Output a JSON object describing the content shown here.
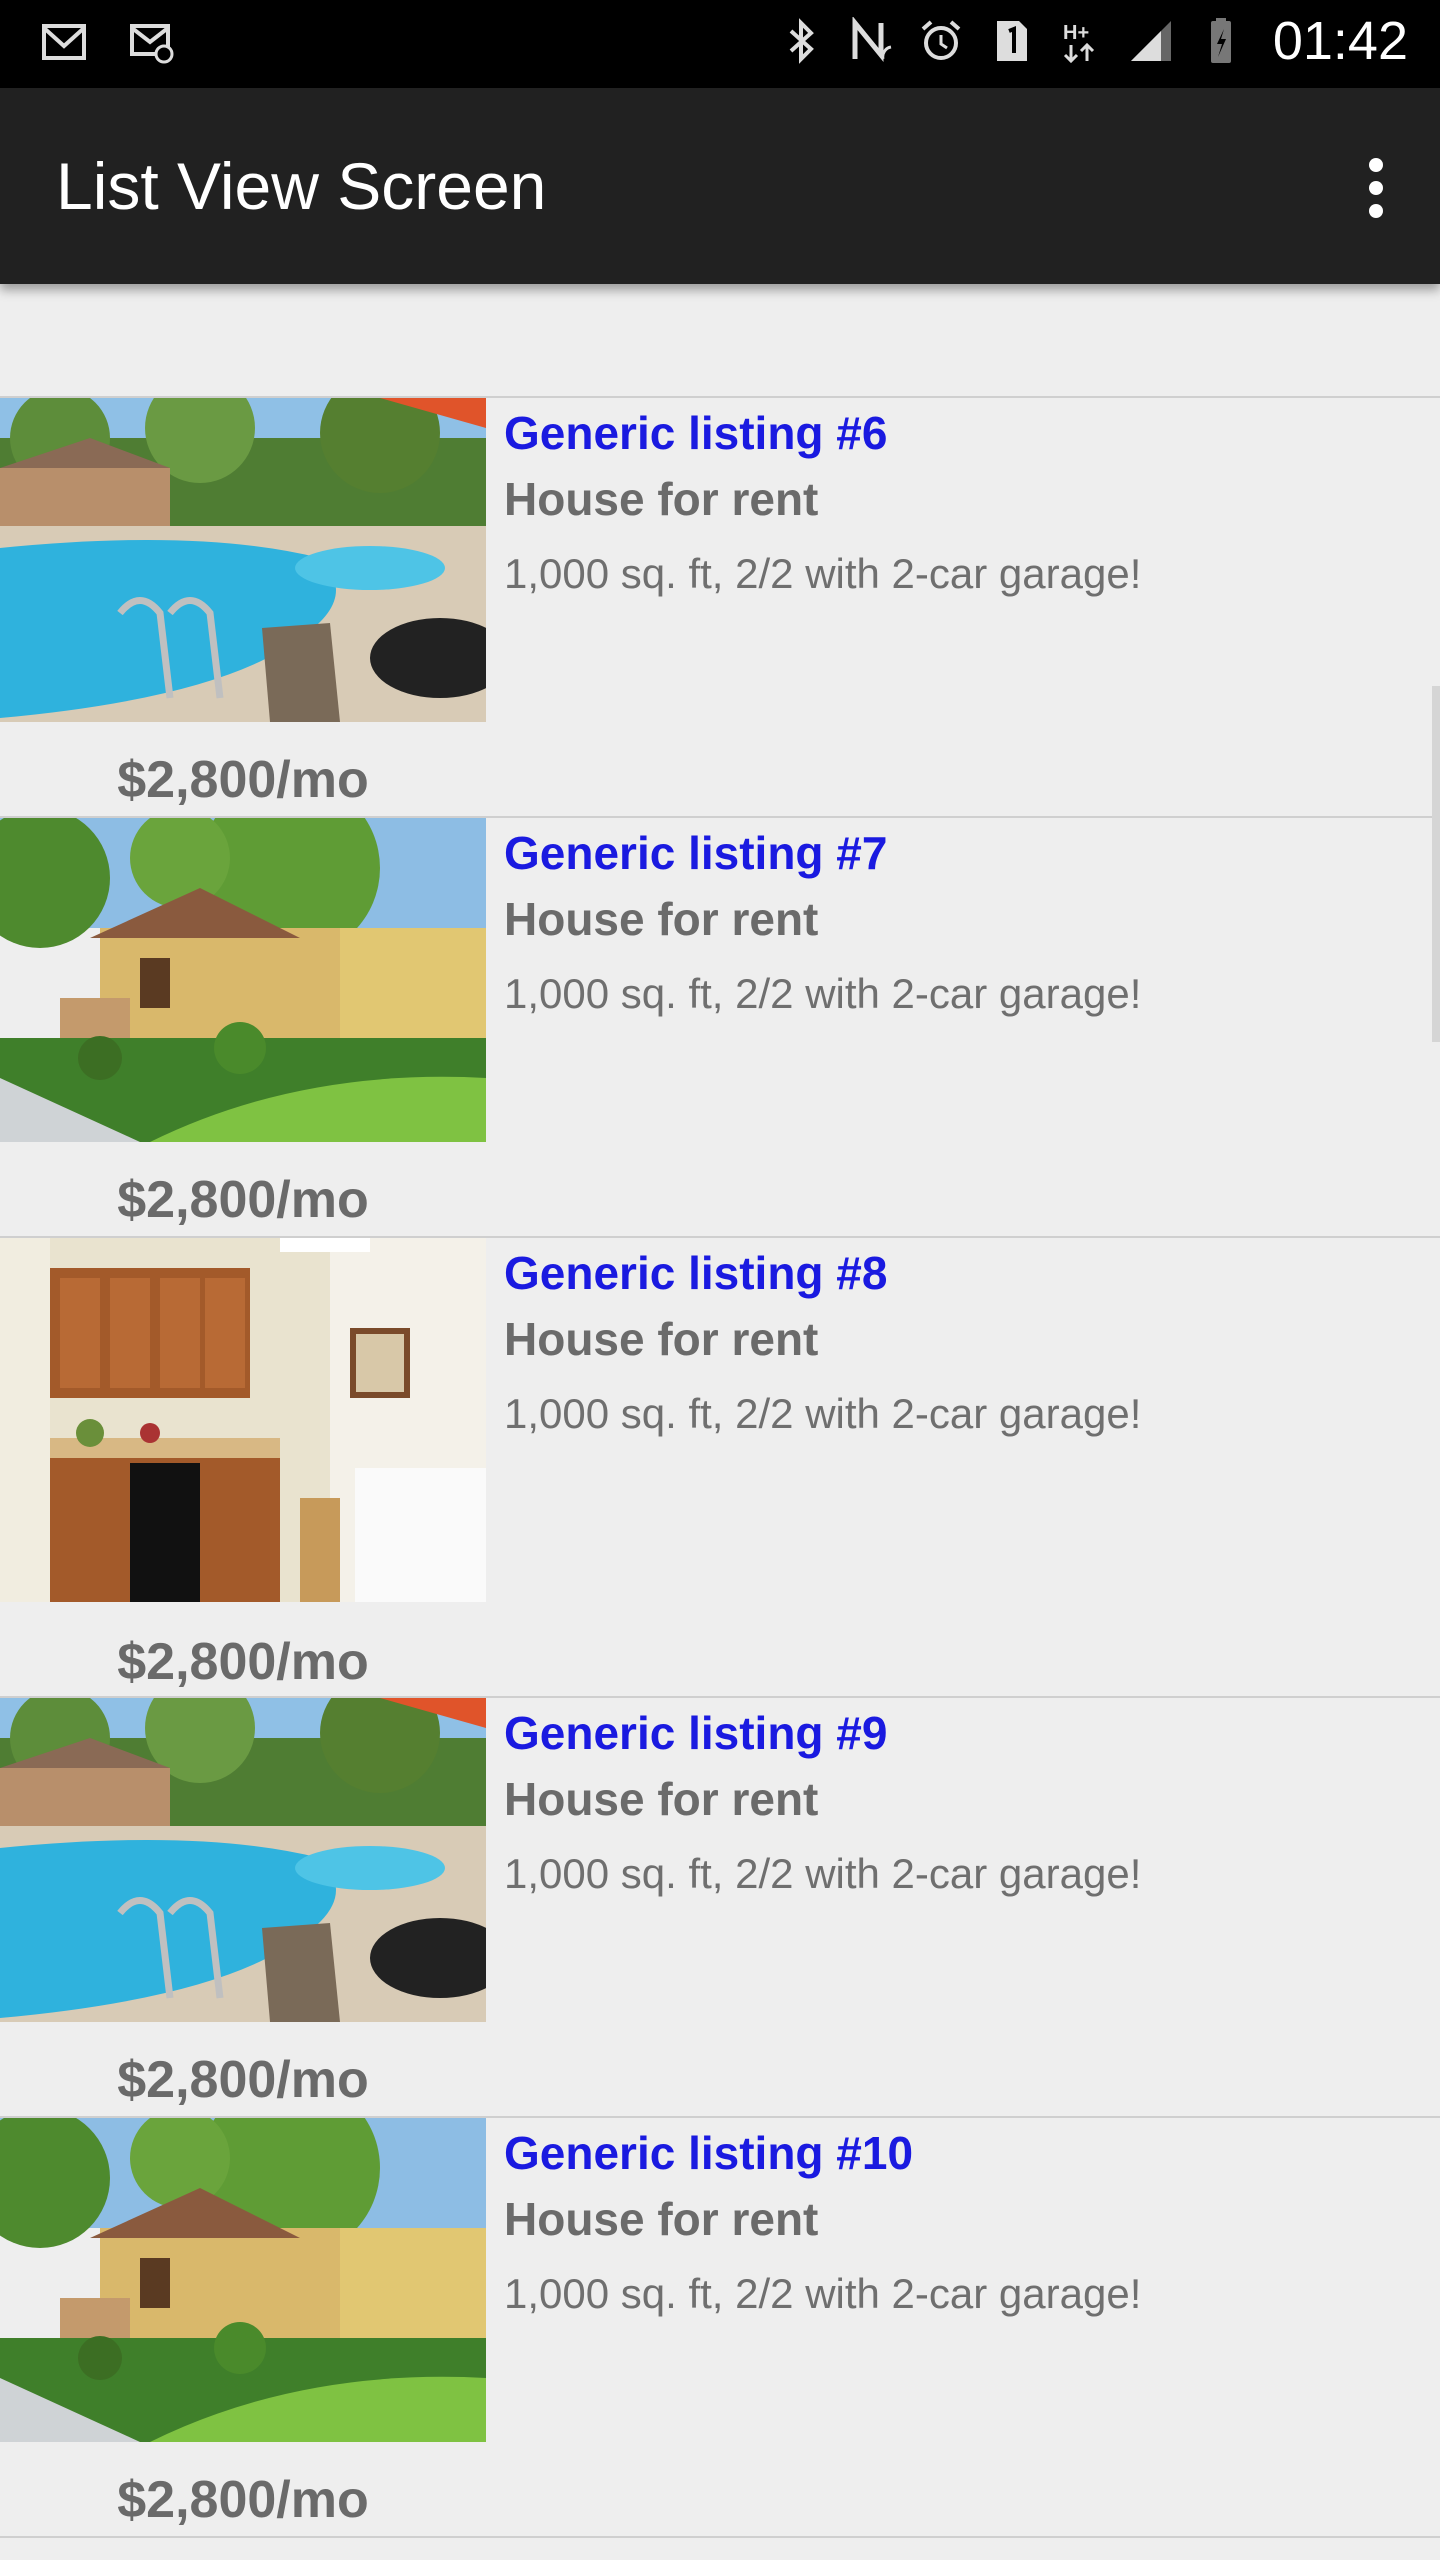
{
  "status_bar": {
    "time": "01:42",
    "left_icons": [
      "gmail-icon",
      "email-icon"
    ],
    "right_icons": [
      "bluetooth-icon",
      "nfc-icon",
      "alarm-icon",
      "sim-icon",
      "data-hplus-icon",
      "signal-icon",
      "battery-icon"
    ]
  },
  "app_bar": {
    "title": "List View Screen",
    "menu_icon": "overflow-menu-icon"
  },
  "listings": [
    {
      "title": "Generic listing #6",
      "subtitle": "House for rent",
      "description": "1,000 sq. ft, 2/2 with 2-car garage!",
      "price": "$2,800/mo",
      "image": "pool"
    },
    {
      "title": "Generic listing #7",
      "subtitle": "House for rent",
      "description": "1,000 sq. ft, 2/2 with 2-car garage!",
      "price": "$2,800/mo",
      "image": "house"
    },
    {
      "title": "Generic listing #8",
      "subtitle": "House for rent",
      "description": "1,000 sq. ft, 2/2 with 2-car garage!",
      "price": "$2,800/mo",
      "image": "kitchen"
    },
    {
      "title": "Generic listing #9",
      "subtitle": "House for rent",
      "description": "1,000 sq. ft, 2/2 with 2-car garage!",
      "price": "$2,800/mo",
      "image": "pool"
    },
    {
      "title": "Generic listing #10",
      "subtitle": "House for rent",
      "description": "1,000 sq. ft, 2/2 with 2-car garage!",
      "price": "$2,800/mo",
      "image": "house"
    }
  ],
  "colors": {
    "title_link": "#1a1ae0",
    "app_bar": "#212121",
    "background": "#eeeeee"
  }
}
